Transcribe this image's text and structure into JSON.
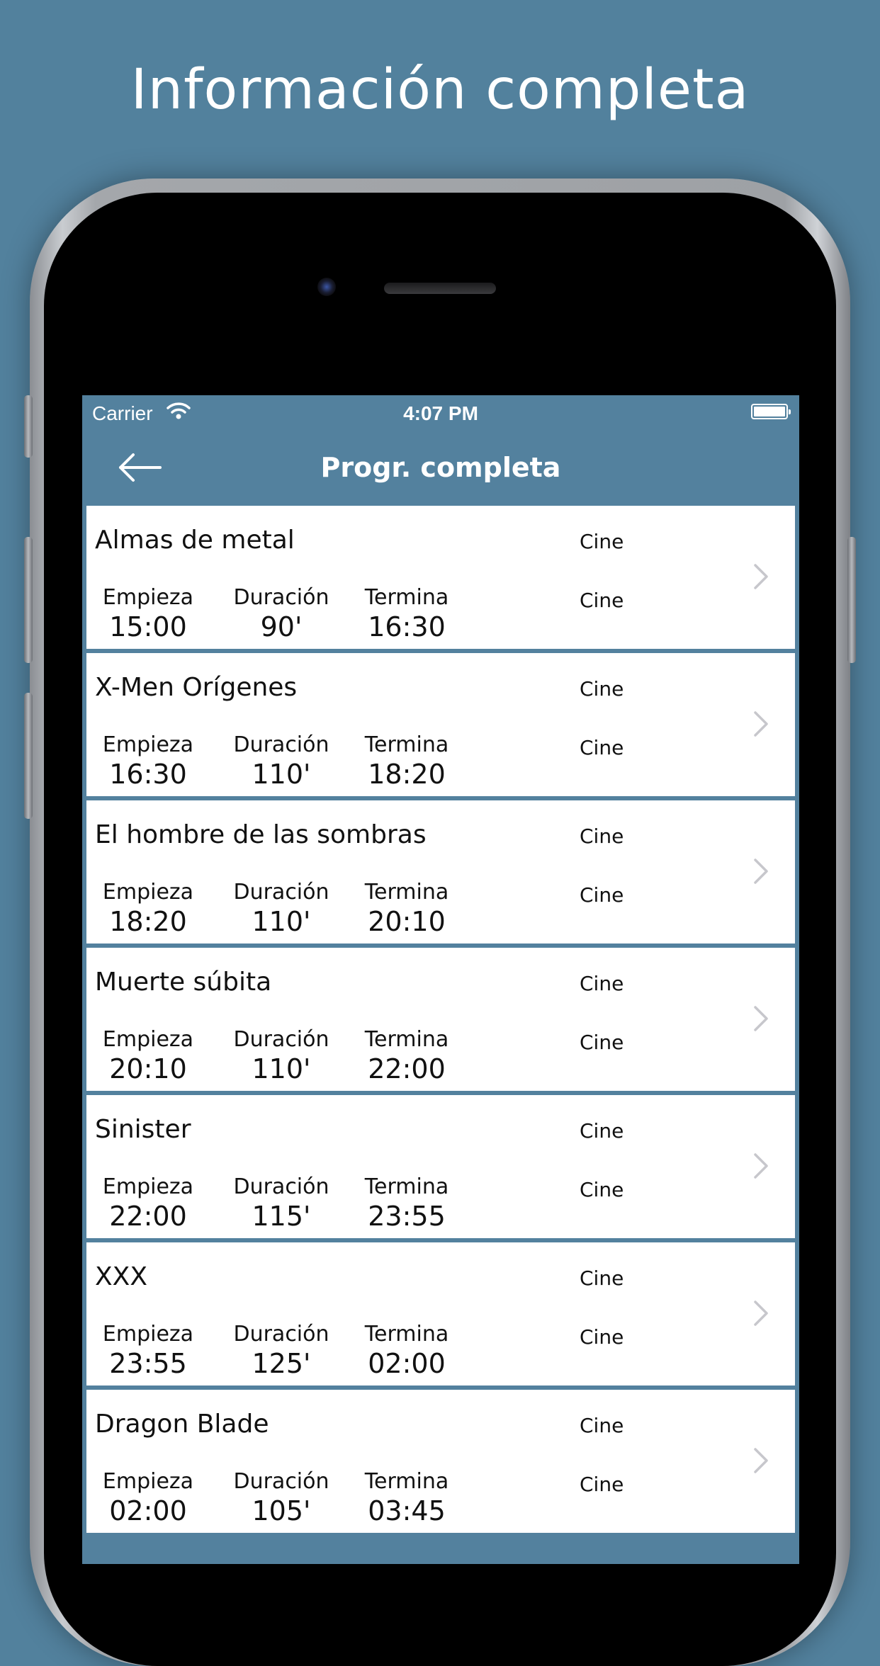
{
  "headline": "Información completa",
  "status": {
    "carrier": "Carrier",
    "time": "4:07 PM"
  },
  "nav": {
    "title": "Progr. completa"
  },
  "labels": {
    "start": "Empieza",
    "duration": "Duración",
    "end": "Termina"
  },
  "items": [
    {
      "title": "Almas de metal",
      "channel": "Cine",
      "channel2": "Cine",
      "start": "15:00",
      "duration": "90'",
      "end": "16:30"
    },
    {
      "title": "X-Men Orígenes",
      "channel": "Cine",
      "channel2": "Cine",
      "start": "16:30",
      "duration": "110'",
      "end": "18:20"
    },
    {
      "title": "El hombre de las sombras",
      "channel": "Cine",
      "channel2": "Cine",
      "start": "18:20",
      "duration": "110'",
      "end": "20:10"
    },
    {
      "title": "Muerte súbita",
      "channel": "Cine",
      "channel2": "Cine",
      "start": "20:10",
      "duration": "110'",
      "end": "22:00"
    },
    {
      "title": "Sinister",
      "channel": "Cine",
      "channel2": "Cine",
      "start": "22:00",
      "duration": "115'",
      "end": "23:55"
    },
    {
      "title": "XXX",
      "channel": "Cine",
      "channel2": "Cine",
      "start": "23:55",
      "duration": "125'",
      "end": "02:00"
    },
    {
      "title": "Dragon Blade",
      "channel": "Cine",
      "channel2": "Cine",
      "start": "02:00",
      "duration": "105'",
      "end": "03:45"
    }
  ],
  "colors": {
    "background": "#52819d",
    "nav": "#53819e",
    "row": "#ffffff"
  },
  "icons": {
    "back": "arrow-left-icon",
    "chevron": "chevron-right-icon",
    "wifi": "wifi-icon",
    "battery": "battery-icon"
  }
}
